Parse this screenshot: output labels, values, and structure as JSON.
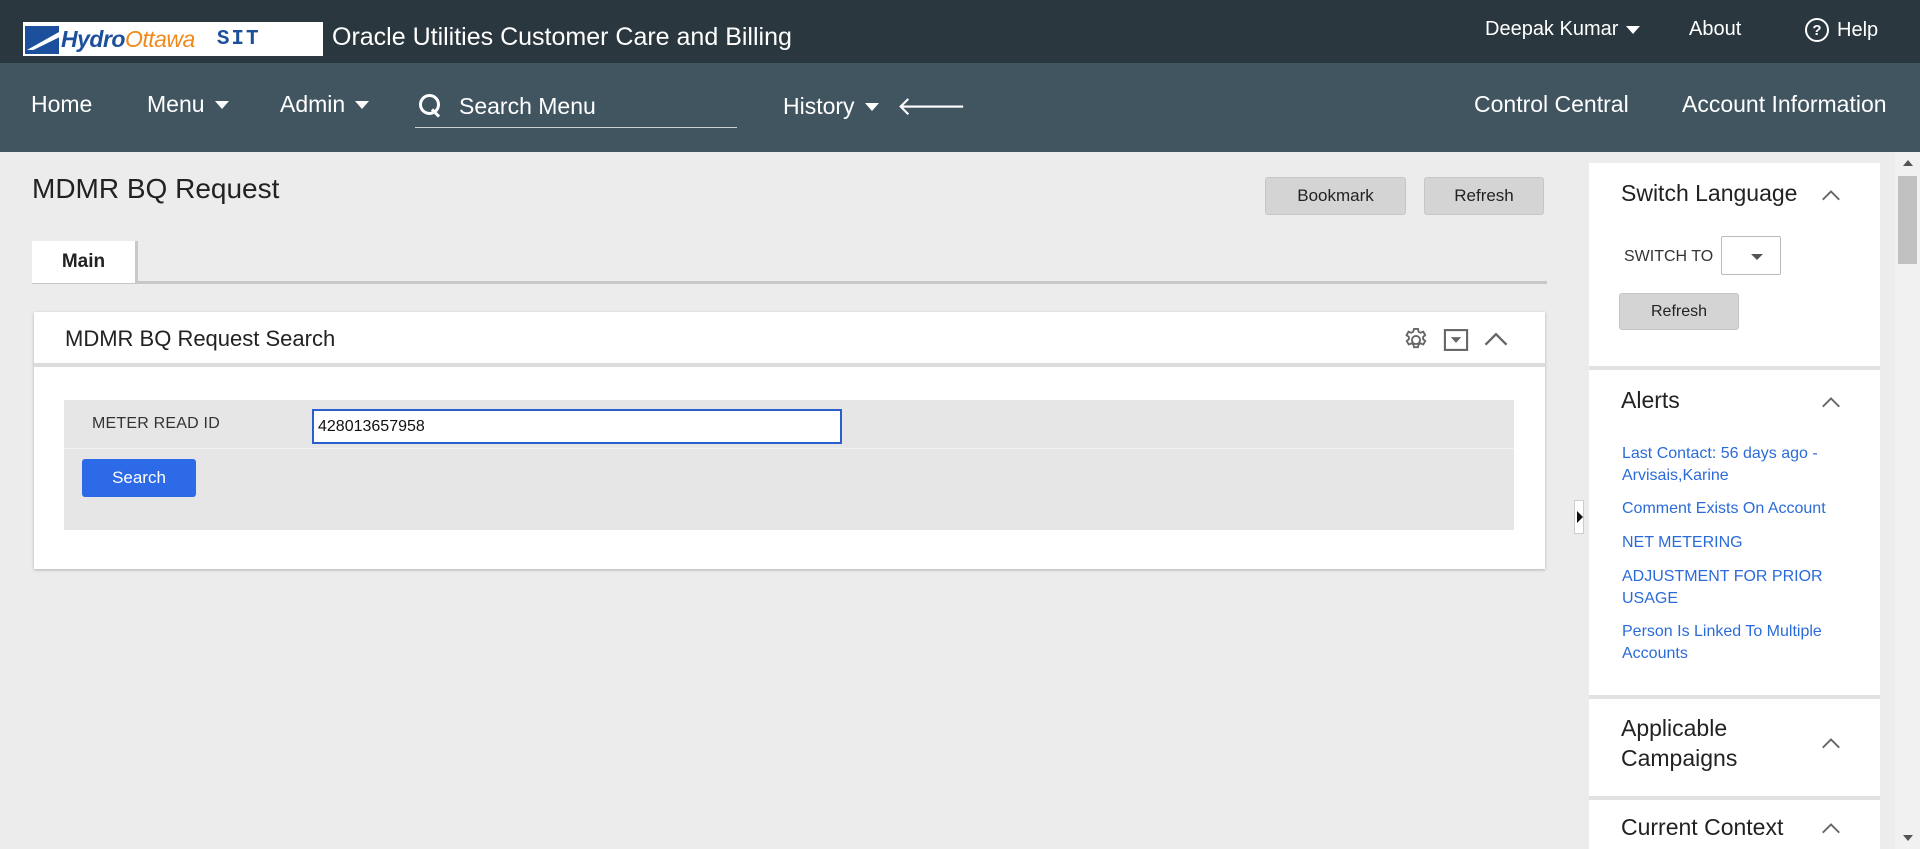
{
  "header": {
    "logo_brand_1": "Hydro",
    "logo_brand_2": "Ottawa",
    "logo_env": "SIT",
    "app_title": "Oracle Utilities Customer Care and Billing",
    "user": "Deepak Kumar",
    "about": "About",
    "help": "Help",
    "help_icon_glyph": "?"
  },
  "nav": {
    "home": "Home",
    "menu": "Menu",
    "admin": "Admin",
    "search_placeholder": "Search Menu",
    "history": "History",
    "back_glyph": "🡐",
    "control_central": "Control Central",
    "account_information": "Account Information"
  },
  "page": {
    "title": "MDMR BQ Request",
    "bookmark": "Bookmark",
    "refresh": "Refresh",
    "tab_main": "Main"
  },
  "zone": {
    "title": "MDMR BQ Request Search",
    "icons": [
      "gear-icon",
      "dropdown-box-icon",
      "chevron-up-icon"
    ],
    "field_label": "METER READ ID",
    "field_value": "428013657958",
    "search_button": "Search"
  },
  "dashboard": {
    "switch_language": {
      "title": "Switch Language",
      "switch_to_label": "SWITCH TO",
      "selected": "",
      "refresh": "Refresh"
    },
    "alerts": {
      "title": "Alerts",
      "items": [
        " Last Contact: 56 days ago - Arvisais,Karine",
        " Comment Exists On Account",
        " NET METERING",
        " ADJUSTMENT FOR PRIOR USAGE",
        " Person Is Linked To Multiple Accounts"
      ]
    },
    "campaigns": {
      "title": "Applicable Campaigns"
    },
    "context": {
      "title": "Current Context"
    }
  },
  "colors": {
    "topbar": "#2a373f",
    "navbar": "#405560",
    "primary_button": "#2d6ae8",
    "link": "#2b6bd9",
    "input_focus": "#2c5fce"
  }
}
